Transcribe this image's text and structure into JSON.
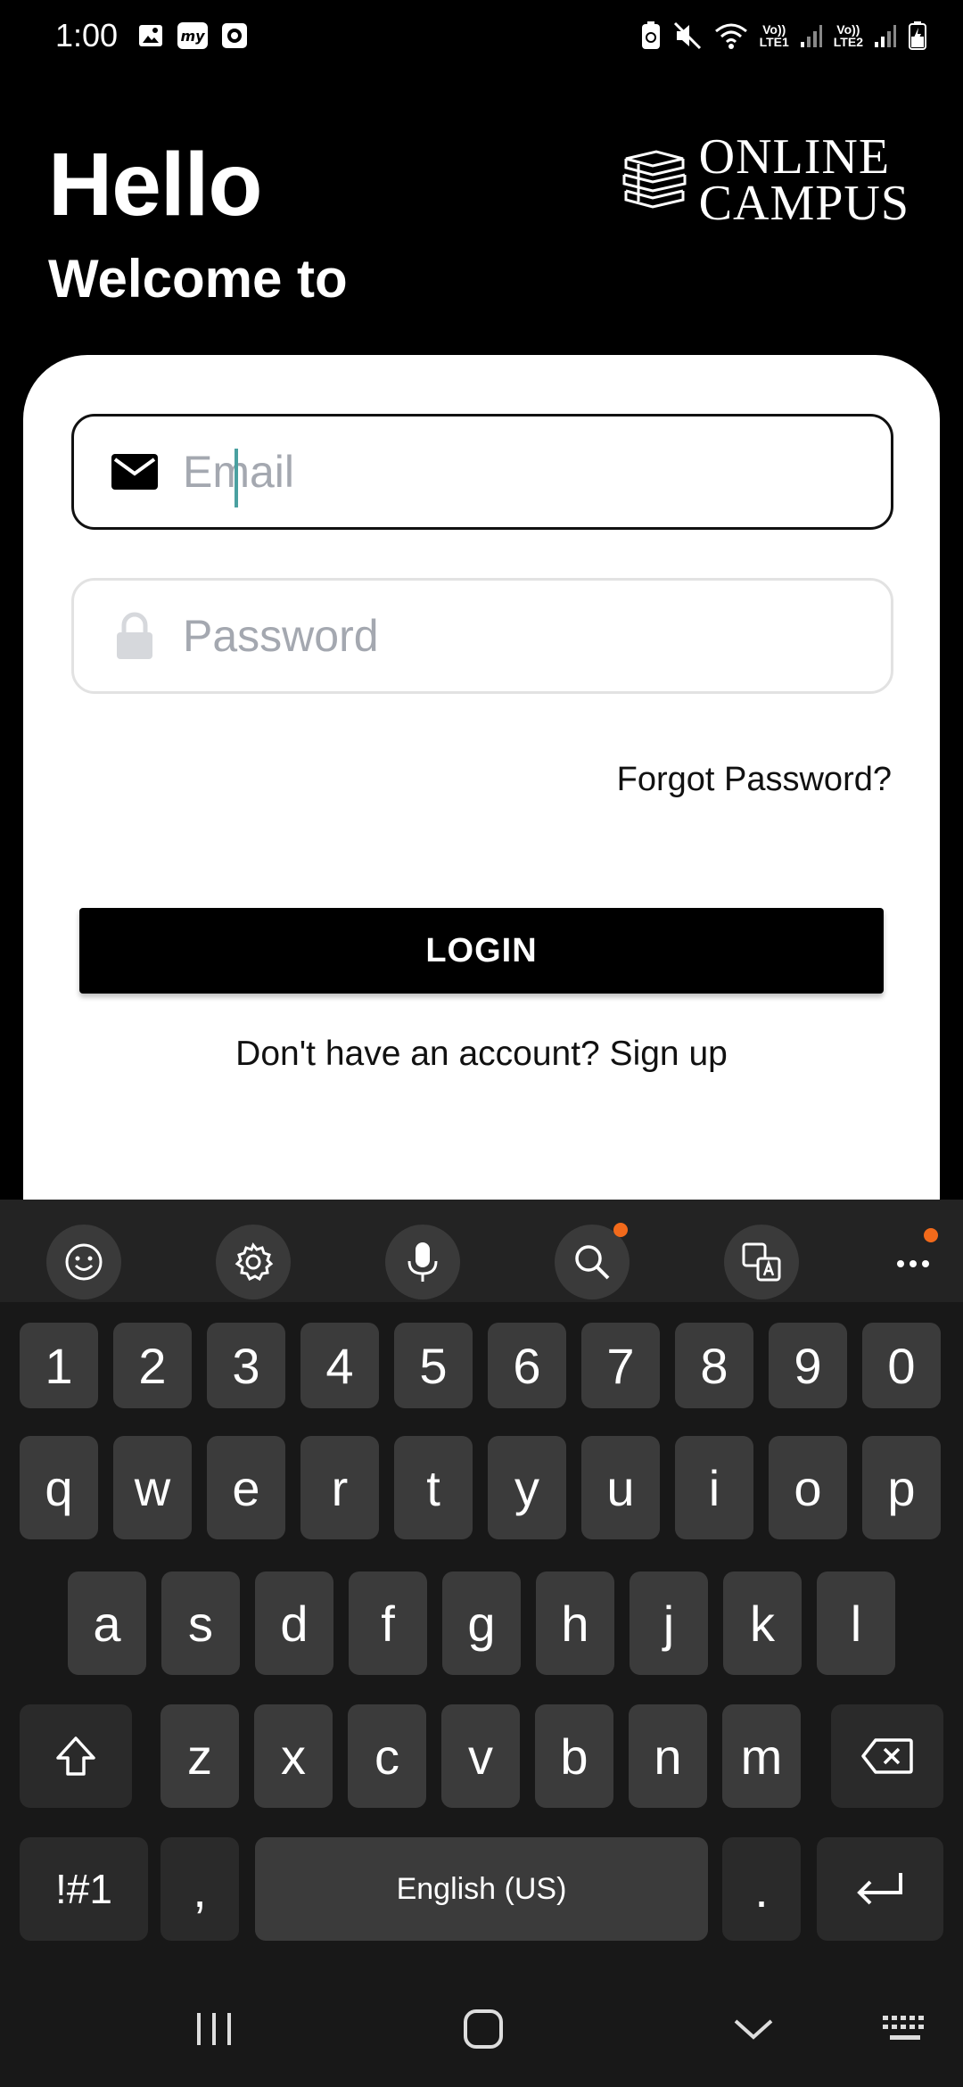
{
  "status_bar": {
    "time": "1:00",
    "sim1_top": "Vo))",
    "sim1_bottom": "LTE1",
    "sim2_top": "Vo))",
    "sim2_bottom": "LTE2"
  },
  "header": {
    "greeting": "Hello",
    "subtitle": "Welcome to",
    "logo_line1": "ONLINE",
    "logo_line2": "CAMPUS"
  },
  "form": {
    "email_placeholder": "Email",
    "email_value": "",
    "password_placeholder": "Password",
    "password_value": "",
    "forgot_label": "Forgot Password?",
    "login_label": "LOGIN",
    "signup_label": "Don't have an account? Sign up"
  },
  "keyboard": {
    "toolbar": [
      "emoji-icon",
      "settings-icon",
      "mic-icon",
      "search-icon",
      "translate-icon",
      "more-icon"
    ],
    "row_numbers": [
      "1",
      "2",
      "3",
      "4",
      "5",
      "6",
      "7",
      "8",
      "9",
      "0"
    ],
    "row_top": [
      "q",
      "w",
      "e",
      "r",
      "t",
      "y",
      "u",
      "i",
      "o",
      "p"
    ],
    "row_middle": [
      "a",
      "s",
      "d",
      "f",
      "g",
      "h",
      "j",
      "k",
      "l"
    ],
    "row_bottom": [
      "z",
      "x",
      "c",
      "v",
      "b",
      "n",
      "m"
    ],
    "symbols_label": "!#1",
    "comma_label": ",",
    "space_label": "English (US)",
    "period_label": "."
  },
  "colors": {
    "background": "#000000",
    "card": "#ffffff",
    "accent_dot": "#f26a1b",
    "key": "#3b3b3b",
    "keyboard_bg": "#181818"
  }
}
